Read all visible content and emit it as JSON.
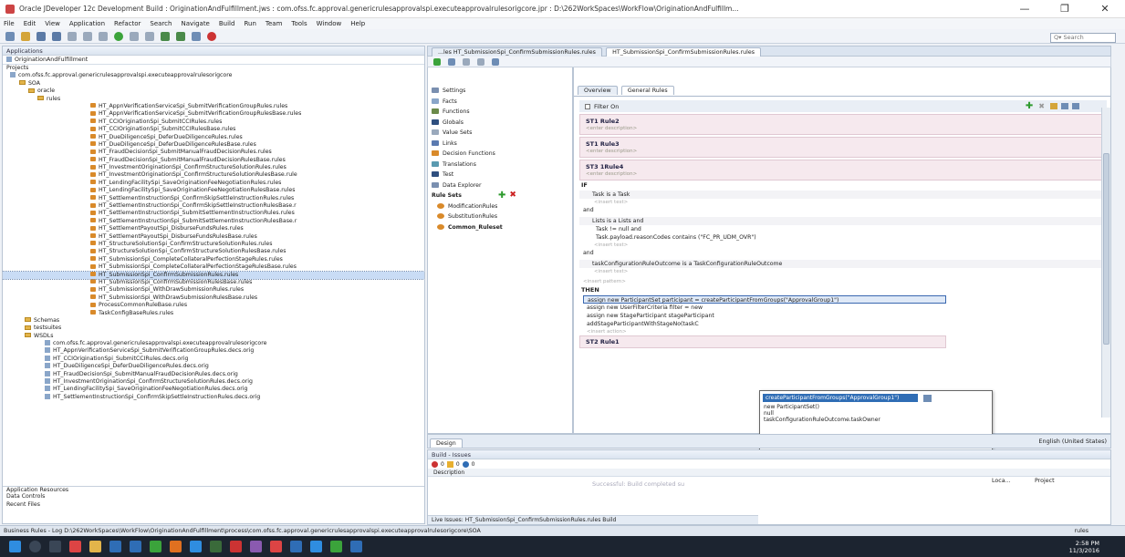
{
  "window": {
    "title": "Oracle JDeveloper 12c Development Build : OriginationAndFulfillment.jws : com.ofss.fc.approval.genericrulesapprovalspi.executeapprovalrulesorigcore.jpr : D:\\262WorkSpaces\\WorkFlow\\OriginationAndFulfillm...",
    "minimize": "—",
    "maximize": "❐",
    "close": "✕"
  },
  "menu": [
    "File",
    "Edit",
    "View",
    "Application",
    "Refactor",
    "Search",
    "Navigate",
    "Build",
    "Run",
    "Team",
    "Tools",
    "Window",
    "Help"
  ],
  "search": {
    "placeholder": "Q▾ Search"
  },
  "applications": {
    "header": "Applications",
    "app_name": "OriginationAndFulfillment",
    "projects_label": "Projects",
    "project": "com.ofss.fc.approval.genericrulesapprovalspi.executeapprovalrulesorigcore",
    "soa": "SOA",
    "oracle": "oracle",
    "rules": "rules",
    "rule_files": [
      "HT_AppnVerificationServiceSpi_SubmitVerificationGroupRules.rules",
      "HT_AppnVerificationServiceSpi_SubmitVerificationGroupRulesBase.rules",
      "HT_CCIOriginationSpi_SubmitCCIRules.rules",
      "HT_CCIOriginationSpi_SubmitCCIRulesBase.rules",
      "HT_DueDiligenceSpi_DeferDueDiligenceRules.rules",
      "HT_DueDiligenceSpi_DeferDueDiligenceRulesBase.rules",
      "HT_FraudDecisionSpi_SubmitManualFraudDecisionRules.rules",
      "HT_FraudDecisionSpi_SubmitManualFraudDecisionRulesBase.rules",
      "HT_InvestmentOriginationSpi_ConfirmStructureSolutionRules.rules",
      "HT_InvestmentOriginationSpi_ConfirmStructureSolutionRulesBase.rule",
      "HT_LendingFacilitySpi_SaveOriginationFeeNegotiationRules.rules",
      "HT_LendingFacilitySpi_SaveOriginationFeeNegotiationRulesBase.rules",
      "HT_SettlementInstructionSpi_ConfirmSkipSettleInstructionRules.rules",
      "HT_SettlementInstructionSpi_ConfirmSkipSettleInstructionRulesBase.r",
      "HT_SettlementInstructionSpi_SubmitSettlementInstructionRules.rules",
      "HT_SettlementInstructionSpi_SubmitSettlementInstructionRulesBase.r",
      "HT_SettlementPayoutSpi_DisburseFundsRules.rules",
      "HT_SettlementPayoutSpi_DisburseFundsRulesBase.rules",
      "HT_StructureSolutionSpi_ConfirmStructureSolutionRules.rules",
      "HT_StructureSolutionSpi_ConfirmStructureSolutionRulesBase.rules",
      "HT_SubmissionSpi_CompleteCollateralPerfectionStageRules.rules",
      "HT_SubmissionSpi_CompleteCollateralPerfectionStageRulesBase.rules",
      "HT_SubmissionSpi_ConfirmSubmissionRules.rules",
      "HT_SubmissionSpi_ConfirmSubmissionRulesBase.rules",
      "HT_SubmissionSpi_WithDrawSubmissionRules.rules",
      "HT_SubmissionSpi_WithDrawSubmissionRulesBase.rules",
      "ProcessCommonRuleBase.rules",
      "TaskConfigBaseRules.rules"
    ],
    "selected_index": 22,
    "folders": [
      "Schemas",
      "testsuites",
      "WSDLs"
    ],
    "deco_files": [
      "com.ofss.fc.approval.genericrulesapprovalspi.executeapprovalrulesorigcore",
      "HT_AppnVerificationServiceSpi_SubmitVerificationGroupRules.decs.orig",
      "HT_CCIOriginationSpi_SubmitCCIRules.decs.orig",
      "HT_DueDiligenceSpi_DeferDueDiligenceRules.decs.orig",
      "HT_FraudDecisionSpi_SubmitManualFraudDecisionRules.decs.orig",
      "HT_InvestmentOriginationSpi_ConfirmStructureSolutionRules.decs.orig",
      "HT_LendingFacilitySpi_SaveOriginationFeeNegotiationRules.decs.orig",
      "HT_SettlementInstructionSpi_ConfirmSkipSettleInstructionRules.decs.orig"
    ],
    "bottom_sections": [
      "Application Resources",
      "Data Controls",
      "Recent Files"
    ]
  },
  "editor_tabs": {
    "tab1": "...les  HT_SubmissionSpi_ConfirmSubmissionRules.rules",
    "tab2": "HT_SubmissionSpi_ConfirmSubmissionRules.rules"
  },
  "rules_nav": {
    "items": [
      "Settings",
      "Facts",
      "Functions",
      "Globals",
      "Value Sets",
      "Links",
      "Decision Functions",
      "Translations",
      "Test",
      "Data Explorer"
    ],
    "rule_sets_label": "Rule Sets",
    "rule_sets": [
      "ModificationRules",
      "SubstitutionRules",
      "Common_Ruleset"
    ]
  },
  "rules_editor": {
    "tabs": [
      "Overview",
      "General Rules"
    ],
    "filter_label": "Filter On",
    "rules": [
      {
        "name": "ST1 Rule2",
        "desc": "<enter description>"
      },
      {
        "name": "ST1 Rule3",
        "desc": "<enter description>"
      },
      {
        "name": "ST3 1Rule4",
        "desc": "<enter description>"
      }
    ],
    "if_label": "IF",
    "conditions": [
      {
        "text": "Task is a Task",
        "insert": "<insert test>"
      },
      {
        "text": "and"
      },
      {
        "text": "Lists is a Lists  and"
      },
      {
        "text": "Task  != null and"
      },
      {
        "text": "Task.payload.reasonCodes  contains  (\"FC_PR_UDM_OVR\")",
        "insert": "<insert test>"
      },
      {
        "text": "and"
      },
      {
        "text": "taskConfigurationRuleOutcome is a TaskConfigurationRuleOutcome",
        "insert": "<insert test>"
      }
    ],
    "insert_pattern": "<insert pattern>",
    "then_label": "THEN",
    "actions": [
      "assign new ParticipantSet participant = createParticipantFromGroups(\"ApprovalGroup1\")",
      "assign new UserFilterCriteria filter = new",
      "assign new StageParticipant stageParticipant",
      "addStageParticipantWithStageNo(taskC"
    ],
    "insert_action": "<insert action>",
    "next_rule": "ST2 Rule1"
  },
  "autocomplete": {
    "selected": "createParticipantFromGroups(\"ApprovalGroup1\")",
    "options": [
      "new ParticipantSet()",
      "null",
      "taskConfigurationRuleOutcome.taskOwner"
    ]
  },
  "design_tab": "Design",
  "locale": "English (United States)",
  "issues": {
    "header": "Build - Issues",
    "counts": [
      "0",
      "0",
      "0"
    ],
    "description_col": "Description",
    "message": "Successful: Build completed su",
    "col_location": "Loca...",
    "col_project": "Project",
    "bottom_tabs": "Live Issues: HT_SubmissionSpi_ConfirmSubmissionRules.rules    Build"
  },
  "statusbar": "Business Rules - Log   D:\\262WorkSpaces\\WorkFlow\\OriginationAndFulfillment\\process\\com.ofss.fc.approval.genericrulesapprovalspi.executeapprovalrulesorigcore\\SOA",
  "statusbar_right": "rules",
  "taskbar": {
    "time": "2:58 PM",
    "date": "11/3/2016"
  },
  "colors": {
    "accent": "#2f6db5",
    "rule_card": "#f6e9ee",
    "selection": "#c9dcf5",
    "taskbar": "#1c2430"
  }
}
